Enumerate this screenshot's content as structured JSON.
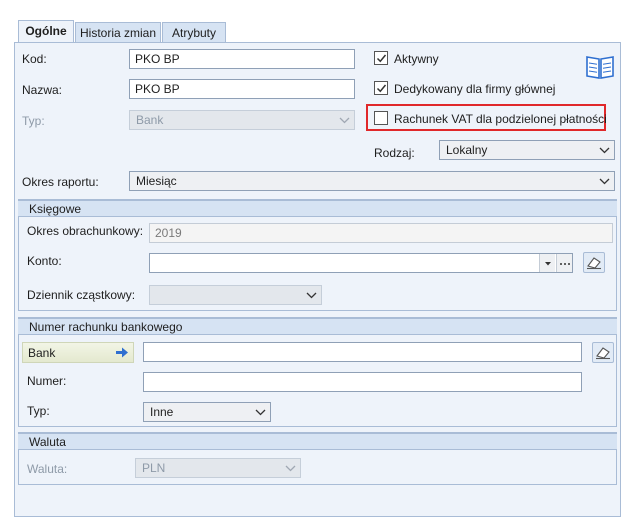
{
  "tabs": [
    {
      "label": "Ogólne"
    },
    {
      "label": "Historia zmian"
    },
    {
      "label": "Atrybuty"
    }
  ],
  "form": {
    "kod_label": "Kod:",
    "kod_value": "PKO BP",
    "nazwa_label": "Nazwa:",
    "nazwa_value": "PKO BP",
    "typ_label": "Typ:",
    "typ_value": "Bank",
    "aktywny_label": "Aktywny",
    "dedykowany_label": "Dedykowany dla firmy głównej",
    "vat_label": "Rachunek VAT dla podzielonej płatności",
    "rodzaj_label": "Rodzaj:",
    "rodzaj_value": "Lokalny",
    "okres_label": "Okres raportu:",
    "okres_value": "Miesiąc",
    "aktywny_checked": true,
    "dedykowany_checked": true,
    "vat_checked": false
  },
  "ksiegowe": {
    "header": "Księgowe",
    "okres_obr_label": "Okres obrachunkowy:",
    "okres_obr_value": "2019",
    "konto_label": "Konto:",
    "konto_value": "",
    "dziennik_label": "Dziennik cząstkowy:",
    "dziennik_value": ""
  },
  "rachunek": {
    "header": "Numer rachunku bankowego",
    "bank_label": "Bank",
    "bank_value": "",
    "numer_label": "Numer:",
    "numer_value": "",
    "typ_label": "Typ:",
    "typ_value": "Inne"
  },
  "waluta": {
    "header": "Waluta",
    "label": "Waluta:",
    "value": "PLN"
  },
  "icons": {
    "book": "book-icon",
    "arrow": "arrow-right-icon",
    "eraser": "eraser-icon",
    "chevron": "chevron-down-icon",
    "ellipsis": "ellipsis-icon"
  },
  "colors": {
    "highlight_border": "#e0282a",
    "panel_bg": "#eef3fa",
    "header_bg": "#d6e3f3",
    "accent_blue": "#2f6fd0"
  }
}
